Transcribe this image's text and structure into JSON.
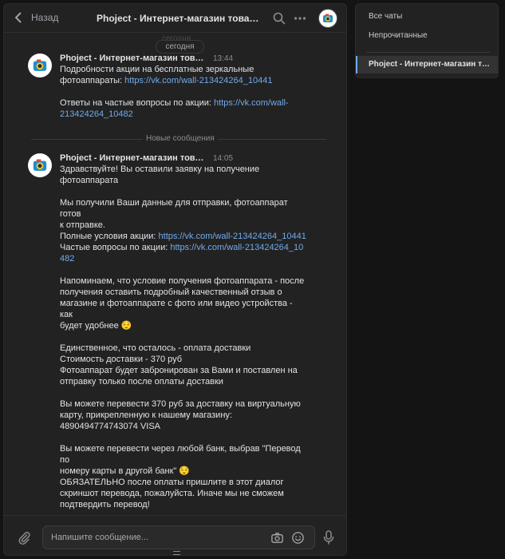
{
  "header": {
    "back_label": "Назад",
    "title": "Phoject - Интернет-магазин товаров для дома"
  },
  "date_separator": {
    "ghost": "сегодня",
    "label": "сегодня"
  },
  "new_messages_label": "Новые сообщения",
  "messages": [
    {
      "sender": "Phoject - Интернет-магазин товаров для дома",
      "time": "13:44",
      "lines": [
        {
          "text": "Подробности акции на бесплатные зеркальные\nфотоаппараты: ",
          "link": "https://vk.com/wall-213424264_10441"
        },
        {
          "text": "\n\nОтветы на частые вопросы по акции: ",
          "link": "https://vk.com/wall-213424264_10482"
        }
      ]
    },
    {
      "sender": "Phoject - Интернет-магазин товаров для дома",
      "time": "14:05",
      "p1": "Здравствуйте! Вы оставили заявку на получение\nфотоаппарата\n\nМы получили Ваши данные для отправки, фотоаппарат готов\nк отправке.\nПолные условия акции: ",
      "link1": "https://vk.com/wall-213424264_10441",
      "p2": "\nЧастые вопросы по акции: ",
      "link2": "https://vk.com/wall-213424264_10482",
      "p3": "\n\nНапоминаем, что условие получения фотоаппарата - после\nполучения оставить подробный качественный отзыв о\nмагазине и фотоаппарате с фото или видео устройства - как\nбудет удобнее 😌\n\nЕдинственное, что осталось - оплата доставки\nСтоимость доставки - 370 руб\nФотоаппарат будет забронирован за Вами и поставлен на\nотправку только после оплаты доставки\n\nВы можете перевести 370 руб за доставку на виртуальную\nкарту, прикрепленную к нашему магазину:\n4890494774743074 VISA\n\nВы можете перевести через любой банк, выбрав \"Перевод по\nномеру карты в другой банк\" 😌\nОБЯЗАТЕЛЬНО после оплаты пришлите в этот диалог\nскриншот перевода, пожалуйста. Иначе мы не сможем\nподтвердить перевод!"
    }
  ],
  "composer": {
    "placeholder": "Напишите сообщение..."
  },
  "sidebar": {
    "all_chats": "Все чаты",
    "unread": "Непрочитанные",
    "active_chat": "Phoject - Интернет-магазин товаров для дома"
  },
  "colors": {
    "link": "#71aaeb",
    "panel": "#222222",
    "background": "#141414"
  }
}
